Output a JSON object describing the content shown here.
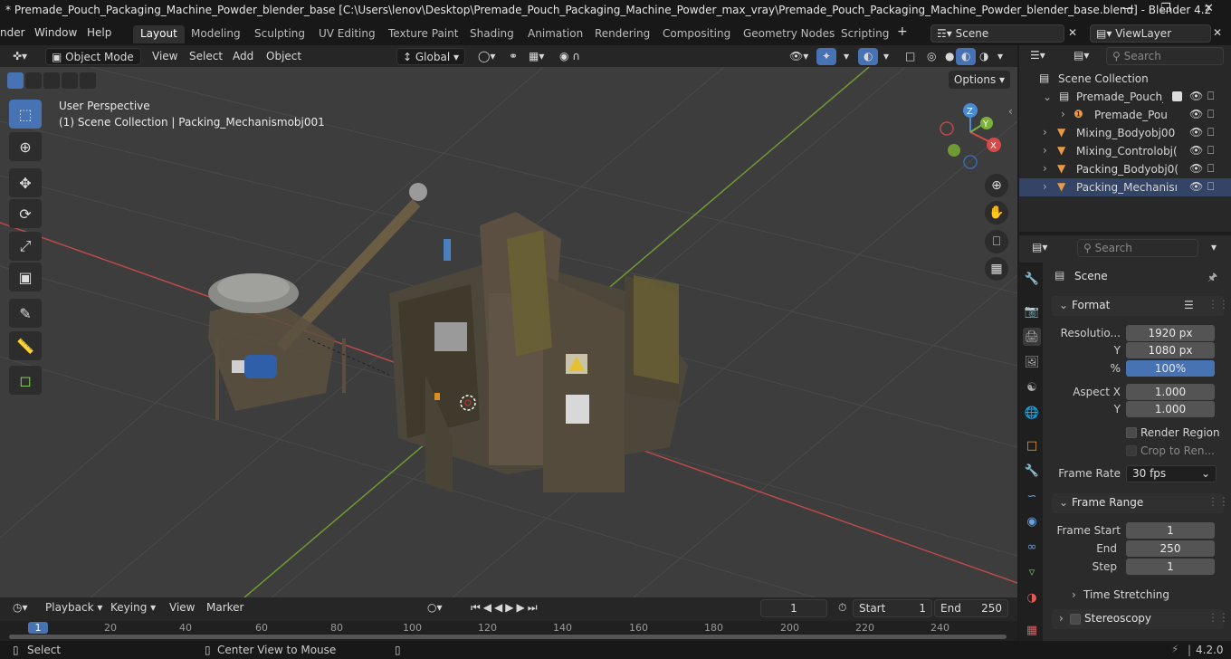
{
  "titlebar": {
    "text": "* Premade_Pouch_Packaging_Machine_Powder_blender_base [C:\\Users\\lenov\\Desktop\\Premade_Pouch_Packaging_Machine_Powder_max_vray\\Premade_Pouch_Packaging_Machine_Powder_blender_base.blend] - Blender 4.2"
  },
  "menus": [
    "nder",
    "Window",
    "Help"
  ],
  "workspaces": [
    "Layout",
    "Modeling",
    "Sculpting",
    "UV Editing",
    "Texture Paint",
    "Shading",
    "Animation",
    "Rendering",
    "Compositing",
    "Geometry Nodes",
    "Scripting"
  ],
  "scene_selector": "Scene",
  "viewlayer_selector": "ViewLayer",
  "viewport_header": {
    "mode": "Object Mode",
    "menus": [
      "View",
      "Select",
      "Add",
      "Object"
    ],
    "transform": "Global",
    "options": "Options"
  },
  "viewport_overlay": {
    "perspective": "User Perspective",
    "collection": "(1) Scene Collection | Packing_Mechanismobj001"
  },
  "gizmo": {
    "x": "X",
    "y": "Y",
    "z": "Z"
  },
  "outliner": {
    "search_placeholder": "Search",
    "rows": [
      {
        "label": "Scene Collection"
      },
      {
        "label": "Premade_Pouch_Pa"
      },
      {
        "label": "Premade_Poucl"
      },
      {
        "label": "Mixing_Bodyobj00"
      },
      {
        "label": "Mixing_Controlobj("
      },
      {
        "label": "Packing_Bodyobj0("
      },
      {
        "label": "Packing_Mechanisı"
      }
    ]
  },
  "properties": {
    "search_placeholder": "Search",
    "context": "Scene",
    "format_header": "Format",
    "resolution_label": "Resolutio...",
    "resolution_x": "1920 px",
    "y_label": "Y",
    "resolution_y": "1080 px",
    "percent_label": "%",
    "resolution_pct": "100%",
    "aspect_x_label": "Aspect X",
    "aspect_x": "1.000",
    "aspect_y": "1.000",
    "render_region": "Render Region",
    "crop_to_render": "Crop to Ren...",
    "frame_rate_label": "Frame Rate",
    "frame_rate": "30 fps",
    "frame_range_header": "Frame Range",
    "frame_start_label": "Frame Start",
    "frame_start": "1",
    "end_label": "End",
    "frame_end": "250",
    "step_label": "Step",
    "frame_step": "1",
    "time_stretching": "Time Stretching",
    "stereoscopy": "Stereoscopy"
  },
  "timeline": {
    "menus": [
      "Playback",
      "Keying",
      "View",
      "Marker"
    ],
    "current_frame": "1",
    "start_label": "Start",
    "start": "1",
    "end_label": "End",
    "end": "250",
    "ruler": [
      "1",
      "20",
      "40",
      "60",
      "80",
      "100",
      "120",
      "140",
      "160",
      "180",
      "200",
      "220",
      "240"
    ]
  },
  "statusbar": {
    "select": "Select",
    "center_view": "Center View to Mouse",
    "version": "4.2.0"
  },
  "colors": {
    "active_tab": "#303030",
    "accent_blue": "#4772b3",
    "axis_x": "#c84848",
    "axis_y": "#7aa83a"
  }
}
